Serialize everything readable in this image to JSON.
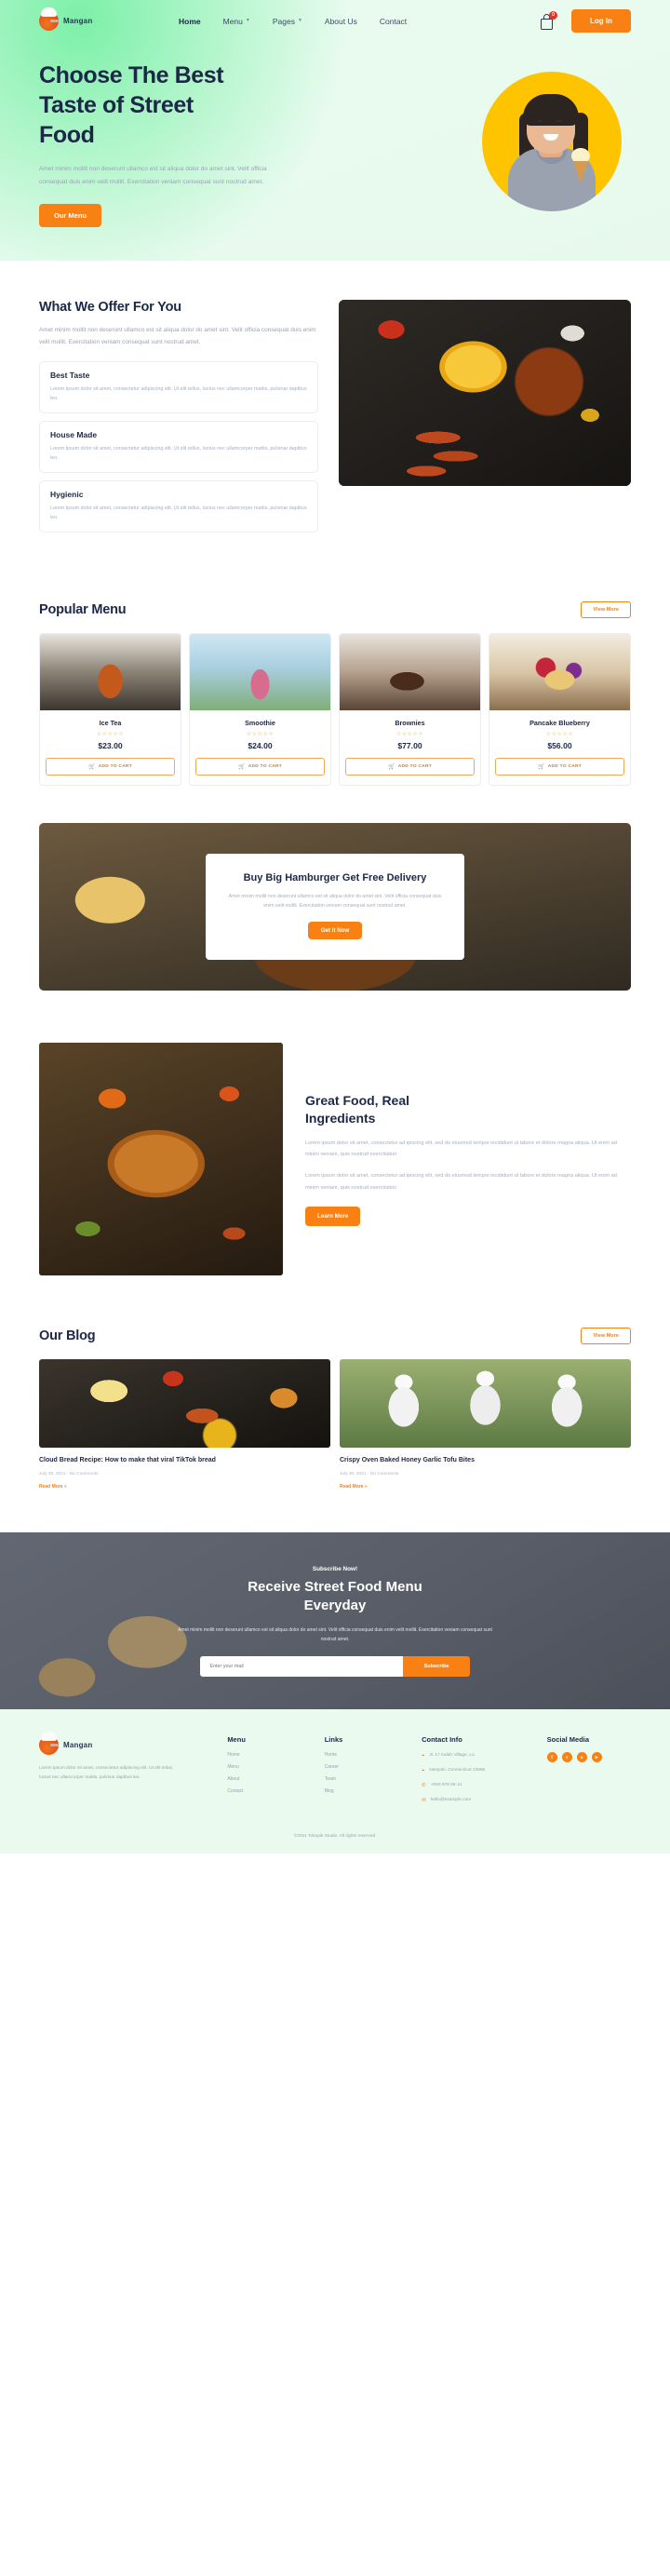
{
  "header": {
    "brand": "Mangan",
    "nav": [
      {
        "label": "Home",
        "active": true,
        "caret": false
      },
      {
        "label": "Menu",
        "active": false,
        "caret": true
      },
      {
        "label": "Pages",
        "active": false,
        "caret": true
      },
      {
        "label": "About Us",
        "active": false,
        "caret": false
      },
      {
        "label": "Contact",
        "active": false,
        "caret": false
      }
    ],
    "cart_count": "0",
    "login_label": "Log In"
  },
  "hero": {
    "title_line1": "Choose The Best",
    "title_line2": "Taste of Street",
    "title_line3": "Food",
    "paragraph": "Amet minim mollit non deserunt ullamco est sit aliqua dolor do amet sint. Velit officia consequat duis enim velit mollit. Exercitation veniam consequat sunt nostrud amet.",
    "cta": "Our Menu"
  },
  "offer": {
    "title": "What We Offer For You",
    "paragraph": "Amet minim mollit non deserunt ullamco est sit aliqua dolor do amet sint. Velit officia consequat duis enim velit mollit. Exercitation veniam consequat sunt nostrud amet.",
    "items": [
      {
        "title": "Best Taste",
        "desc": "Lorem ipsum dolor sit amet, consectetur adipiscing elit. Ut elit tellus, luctus nec ullamcorper mattis, pulvinar dapibus leo."
      },
      {
        "title": "House Made",
        "desc": "Lorem ipsum dolor sit amet, consectetur adipiscing elit. Ut elit tellus, luctus nec ullamcorper mattis, pulvinar dapibus leo."
      },
      {
        "title": "Hygienic",
        "desc": "Lorem ipsum dolor sit amet, consectetur adipiscing elit. Ut elit tellus, luctus nec ullamcorper mattis, pulvinar dapibus leo."
      }
    ]
  },
  "popular": {
    "title": "Popular Menu",
    "view_more": "View More",
    "cart_label": "ADD TO CART",
    "stars": "☆☆☆☆☆",
    "items": [
      {
        "name": "Ice Tea",
        "price": "$23.00"
      },
      {
        "name": "Smoothie",
        "price": "$24.00"
      },
      {
        "name": "Brownies",
        "price": "$77.00"
      },
      {
        "name": "Pancake Blueberry",
        "price": "$56.00"
      }
    ]
  },
  "promo": {
    "title": "Buy Big Hamburger Get Free Delivery",
    "paragraph": "Amet minim mollit non deserunt ullamco est sit aliqua dolor do amet sint. Velit officia consequat duis enim velit mollit. Exercitation veniam consequat sunt nostrud amet.",
    "cta": "Get It Now"
  },
  "great": {
    "title_line1": "Great Food, Real",
    "title_line2": "Ingredients",
    "paragraph1": "Lorem ipsum dolor sit amet, consectetur ad ipiscing elit, sed do eiusmod tempor incididunt ut labore et dolore magna aliqua. Ut enim ad minim veniam, quis nostrud exercitation",
    "paragraph2": "Lorem ipsum dolor sit amet, consectetur ad ipiscing elit, sed do eiusmod tempor incididunt ut labore et dolore magna aliqua. Ut enim ad minim veniam, quis nostrud exercitation",
    "cta": "Learn More"
  },
  "blog": {
    "title": "Our Blog",
    "view_more": "View More",
    "posts": [
      {
        "title": "Cloud Bread Recipe: How to make that viral TikTok bread",
        "meta": "July 30, 2021 - No Comments",
        "more": "Read More »"
      },
      {
        "title": "Crispy Oven Baked Honey Garlic Tofu Bites",
        "meta": "July 30, 2021 - No Comments",
        "more": "Read More »"
      }
    ]
  },
  "subscribe": {
    "eyebrow": "Subscribe Now!",
    "title_line1": "Receive Street Food Menu",
    "title_line2": "Everyday",
    "paragraph": "Amet minim mollit non deserunt ullamco est sit aliqua dolor do amet sint. Velit officia consequat duis enim velit mollit. Exercitation veniam consequat sunt nostrud amet.",
    "placeholder": "Enter your mail",
    "button": "Subscribe"
  },
  "footer": {
    "brand": "Mangan",
    "about": "Lorem ipsum dolor sit amet, consectetur adipiscing elit. Ut elit tellus, luctus nec ullamcorper mattis, pulvinar dapibus leo.",
    "menu": {
      "heading": "Menu",
      "items": [
        "Home",
        "Menu",
        "About",
        "Contact"
      ]
    },
    "links": {
      "heading": "Links",
      "items": [
        "Home",
        "Career",
        "Team",
        "Blog"
      ]
    },
    "contact": {
      "heading": "Contact Info",
      "items": [
        {
          "icon": "location-icon",
          "glyph": "⌖",
          "text": "Jl. 17 Indah Village, Lo"
        },
        {
          "icon": "location-icon",
          "glyph": "⌖",
          "text": "Nanyuki, Connecticut 13566"
        },
        {
          "icon": "phone-icon",
          "glyph": "✆",
          "text": "+000 979 08 14"
        },
        {
          "icon": "mail-icon",
          "glyph": "✉",
          "text": "hello@example.com"
        }
      ]
    },
    "social": {
      "heading": "Social Media",
      "items": [
        {
          "name": "facebook-icon",
          "glyph": "f"
        },
        {
          "name": "twitter-icon",
          "glyph": "t"
        },
        {
          "name": "instagram-icon",
          "glyph": "o"
        },
        {
          "name": "youtube-icon",
          "glyph": "▸"
        }
      ]
    },
    "copyright": "©2021 Tokopik Studio. All rights reserved."
  },
  "colors": {
    "accent": "#f98012",
    "ink": "#1d2747",
    "mint": "#eafaef"
  }
}
